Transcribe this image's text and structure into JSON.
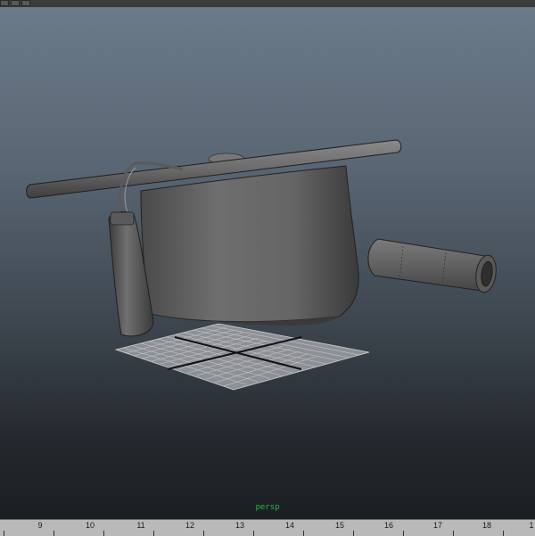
{
  "toolbar": {
    "buttons": [
      "",
      "",
      ""
    ]
  },
  "viewport": {
    "camera_label": "persp",
    "label_color": "#24b24f"
  },
  "timeline": {
    "ticks": [
      "9",
      "10",
      "11",
      "12",
      "13",
      "14",
      "15",
      "16",
      "17",
      "18",
      "1"
    ]
  }
}
